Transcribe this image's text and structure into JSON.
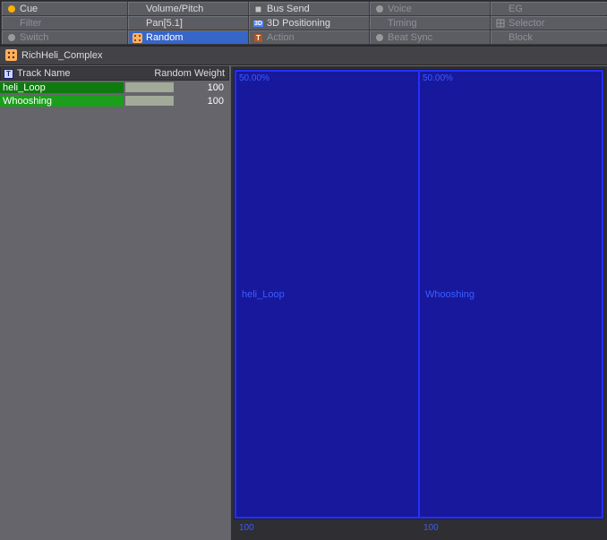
{
  "tabs": {
    "row0": [
      {
        "label": "Cue",
        "dim": false,
        "iconColor": "#ffb000"
      },
      {
        "label": "Volume/Pitch",
        "dim": false,
        "iconColor": null
      },
      {
        "label": "Bus Send",
        "dim": false,
        "iconColor": "#bbbbbb"
      },
      {
        "label": "Voice",
        "dim": true,
        "iconColor": "#9a9a9a"
      },
      {
        "label": "EG",
        "dim": true,
        "iconColor": null
      }
    ],
    "row1": [
      {
        "label": "Filter",
        "dim": true,
        "iconColor": null
      },
      {
        "label": "Pan[5.1]",
        "dim": false,
        "iconColor": null
      },
      {
        "label": "3D Positioning",
        "dim": false,
        "iconColor": "#4a90ff",
        "badge": "3D"
      },
      {
        "label": "Timing",
        "dim": true,
        "iconColor": null
      },
      {
        "label": "Selector",
        "dim": true,
        "iconColor": "#9a9a9a"
      }
    ],
    "row2": [
      {
        "label": "Switch",
        "dim": true,
        "iconColor": "#9a9a9a"
      },
      {
        "label": "Random",
        "dim": false,
        "iconColor": "#ffb000",
        "selected": true
      },
      {
        "label": "Action",
        "dim": true,
        "iconColor": "#b05523",
        "badge": "T"
      },
      {
        "label": "Beat Sync",
        "dim": true,
        "iconColor": "#9a9a9a"
      },
      {
        "label": "Block",
        "dim": true,
        "iconColor": "#9a9a9a"
      }
    ]
  },
  "breadcrumb": "RichHeli_Complex",
  "columns": {
    "name": "Track Name",
    "weight": "Random Weight"
  },
  "rows": [
    {
      "name": "heli_Loop",
      "weight": "100",
      "fillPct": 100
    },
    {
      "name": "Whooshing",
      "weight": "100",
      "fillPct": 100
    }
  ],
  "chart": {
    "pcts": [
      "50.00%",
      "50.00%"
    ],
    "labels": [
      "heli_Loop",
      "Whooshing"
    ],
    "bottom": [
      "100",
      "100"
    ]
  }
}
